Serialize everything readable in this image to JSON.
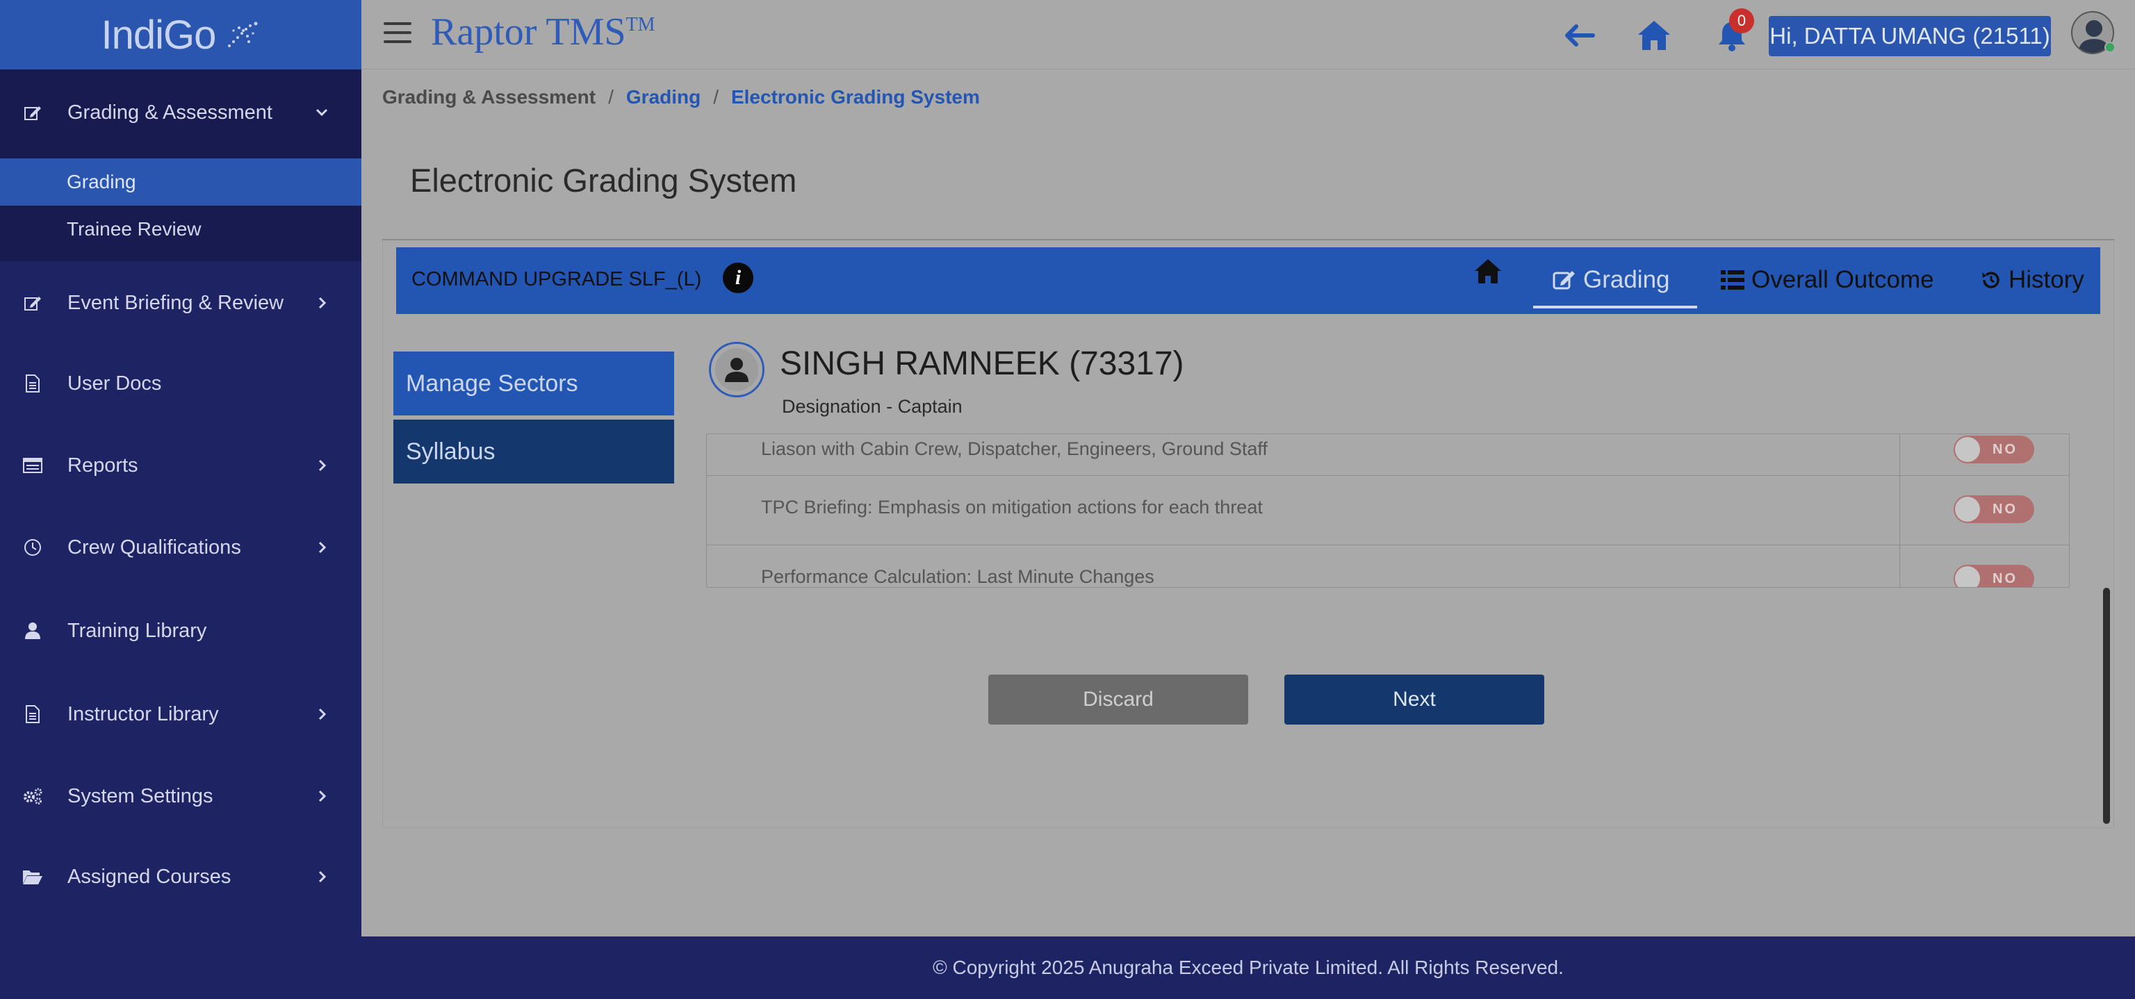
{
  "brand": {
    "logo_text": "IndiGo",
    "app_name": "Raptor TMS",
    "trademark": "TM"
  },
  "sidebar": {
    "items": [
      {
        "label": "Grading & Assessment",
        "icon": "edit-icon",
        "expanded": true
      },
      {
        "label": "Event Briefing & Review",
        "icon": "edit-icon"
      },
      {
        "label": "User Docs",
        "icon": "document-icon"
      },
      {
        "label": "Reports",
        "icon": "report-icon"
      },
      {
        "label": "Crew Qualifications",
        "icon": "clock-icon"
      },
      {
        "label": "Training Library",
        "icon": "user-icon"
      },
      {
        "label": "Instructor Library",
        "icon": "document-icon"
      },
      {
        "label": "System Settings",
        "icon": "gears-icon"
      },
      {
        "label": "Assigned Courses",
        "icon": "folder-open-icon"
      }
    ],
    "subitems": [
      {
        "label": "Grading",
        "active": true
      },
      {
        "label": "Trainee Review",
        "active": false
      }
    ]
  },
  "header": {
    "notification_count": "0",
    "user_greeting": "Hi, DATTA UMANG (21511)"
  },
  "breadcrumb": {
    "level1": "Grading & Assessment",
    "level2": "Grading",
    "level3": "Electronic Grading System",
    "separator": "/"
  },
  "page_title": "Electronic Grading System",
  "course": {
    "name": "COMMAND UPGRADE SLF_(L)",
    "info_symbol": "i",
    "tabs": [
      {
        "label": "Grading",
        "active": true
      },
      {
        "label": "Overall Outcome",
        "active": false
      },
      {
        "label": "History",
        "active": false
      }
    ]
  },
  "side_menu": [
    {
      "label": "Manage Sectors"
    },
    {
      "label": "Syllabus"
    }
  ],
  "trainee": {
    "name": "SINGH RAMNEEK (73317)",
    "designation": "Designation - Captain"
  },
  "grading_rows": [
    {
      "text": "Liason with Cabin Crew, Dispatcher, Engineers, Ground Staff",
      "toggle": "NO"
    },
    {
      "text": "TPC Briefing: Emphasis on mitigation actions for each threat",
      "toggle": "NO"
    },
    {
      "text": "Performance Calculation: Last Minute Changes",
      "toggle": "NO"
    }
  ],
  "actions": {
    "discard": "Discard",
    "next": "Next"
  },
  "footer": {
    "copyright": "© Copyright 2025 Anugraha Exceed Private Limited.  All Rights Reserved."
  },
  "colors": {
    "primary_blue": "#2356b3",
    "sidebar_navy": "#1e2463",
    "next_button": "#14386d",
    "toggle_off": "#b07070"
  }
}
